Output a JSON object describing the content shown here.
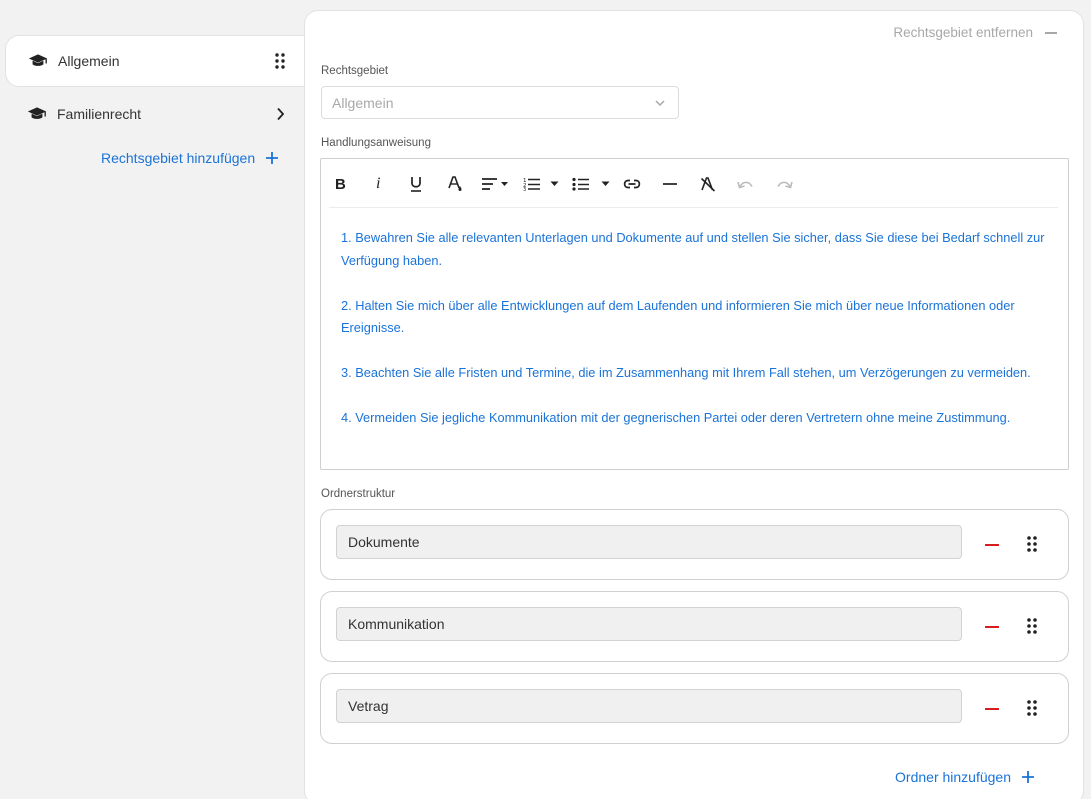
{
  "sidebar": {
    "items": [
      {
        "label": "Allgemein",
        "icon": "graduation-cap-icon",
        "trailing_icon": "drag-handle-icon",
        "active": true
      },
      {
        "label": "Familienrecht",
        "icon": "graduation-cap-icon",
        "trailing_icon": "chevron-right-icon",
        "active": false
      }
    ],
    "add_label": "Rechtsgebiet hinzufügen"
  },
  "panel": {
    "remove_label": "Rechtsgebiet entfernen",
    "rechtsgebiet": {
      "label": "Rechtsgebiet",
      "value": "Allgemein"
    },
    "handlungsanweisung": {
      "label": "Handlungsanweisung",
      "toolbar": [
        "bold",
        "italic",
        "underline",
        "text-color",
        "align",
        "ordered-list",
        "bullet-list",
        "link",
        "horizontal-rule",
        "clear-format",
        "undo",
        "redo"
      ],
      "paragraphs": [
        "1. Bewahren Sie alle relevanten Unterlagen und Dokumente auf und stellen Sie sicher, dass Sie diese bei Bedarf schnell zur Verfügung haben.",
        " 2. Halten Sie mich über alle Entwicklungen auf dem Laufenden und informieren Sie mich über neue Informationen oder Ereignisse.",
        " 3. Beachten Sie alle Fristen und Termine, die im Zusammenhang mit Ihrem Fall stehen, um Verzögerungen zu vermeiden.",
        " 4. Vermeiden Sie jegliche Kommunikation mit der gegnerischen Partei oder deren Vertretern ohne meine Zustimmung."
      ]
    },
    "ordnerstruktur": {
      "label": "Ordnerstruktur",
      "folders": [
        "Dokumente",
        "Kommunikation",
        "Vetrag"
      ],
      "add_label": "Ordner hinzufügen"
    }
  },
  "colors": {
    "accent": "#1a73d8",
    "danger": "#d81e1e",
    "muted": "#a8a8a8"
  }
}
